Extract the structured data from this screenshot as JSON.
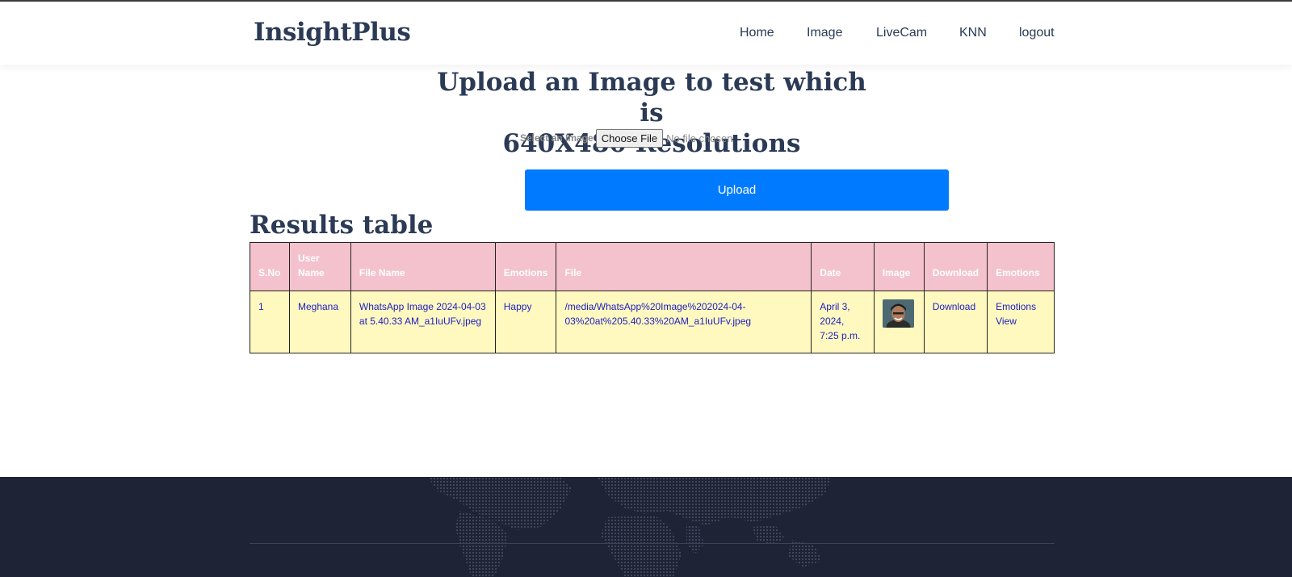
{
  "brand": "InsightPlus",
  "nav": [
    {
      "label": "Home"
    },
    {
      "label": "Image"
    },
    {
      "label": "LiveCam"
    },
    {
      "label": "KNN"
    },
    {
      "label": "logout"
    }
  ],
  "upload": {
    "title_line1": "Upload an Image to test which is",
    "title_line2": "640X480 Resolutions",
    "select_label": "Select an Image",
    "choose_file": "Choose File",
    "no_file": "No file chosen",
    "button": "Upload"
  },
  "results": {
    "title": "Results table",
    "headers": [
      "S.No",
      "User Name",
      "File Name",
      "Emotions",
      "File",
      "Date",
      "Image",
      "Download",
      "Emotions"
    ],
    "rows": [
      {
        "sno": "1",
        "user": "Meghana",
        "file_name": "WhatsApp Image 2024-04-03 at 5.40.33 AM_a1IuUFv.jpeg",
        "emotion": "Happy",
        "file": "/media/WhatsApp%20Image%202024-04-03%20at%205.40.33%20AM_a1IuUFv.jpeg",
        "date": "April 3, 2024, 7:25 p.m.",
        "image_icon": "user-photo-thumbnail",
        "download": "Download",
        "view": "Emotions View"
      }
    ]
  },
  "colors": {
    "accent": "#007bff",
    "header_bg": "#f4c2cc",
    "row_bg": "#fff9c0",
    "footer_bg": "#1e2436",
    "heading": "#2b3a55"
  }
}
